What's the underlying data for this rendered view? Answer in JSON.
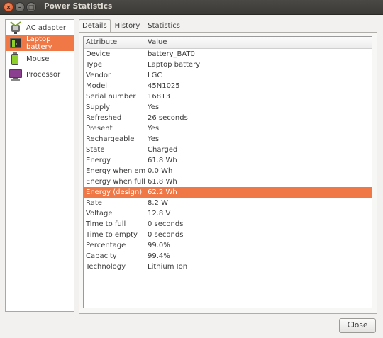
{
  "window": {
    "title": "Power Statistics",
    "close_glyph": "×",
    "minimize_glyph": "–",
    "maximize_glyph": "□"
  },
  "devices": [
    {
      "label": "AC adapter",
      "icon": "ac-adapter-icon",
      "selected": false
    },
    {
      "label": "Laptop battery",
      "icon": "battery-icon",
      "selected": true
    },
    {
      "label": "Mouse",
      "icon": "mouse-battery-icon",
      "selected": false
    },
    {
      "label": "Processor",
      "icon": "processor-icon",
      "selected": false
    }
  ],
  "tabs": [
    {
      "label": "Details",
      "active": true
    },
    {
      "label": "History",
      "active": false
    },
    {
      "label": "Statistics",
      "active": false
    }
  ],
  "table": {
    "headers": {
      "attribute": "Attribute",
      "value": "Value"
    },
    "rows": [
      {
        "attribute": "Device",
        "value": "battery_BAT0"
      },
      {
        "attribute": "Type",
        "value": "Laptop battery"
      },
      {
        "attribute": "Vendor",
        "value": "LGC"
      },
      {
        "attribute": "Model",
        "value": "45N1025"
      },
      {
        "attribute": "Serial number",
        "value": "16813"
      },
      {
        "attribute": "Supply",
        "value": "Yes"
      },
      {
        "attribute": "Refreshed",
        "value": "26 seconds"
      },
      {
        "attribute": "Present",
        "value": "Yes"
      },
      {
        "attribute": "Rechargeable",
        "value": "Yes"
      },
      {
        "attribute": "State",
        "value": "Charged"
      },
      {
        "attribute": "Energy",
        "value": "61.8 Wh"
      },
      {
        "attribute": "Energy when empty",
        "value": "0.0 Wh"
      },
      {
        "attribute": "Energy when full",
        "value": "61.8 Wh"
      },
      {
        "attribute": "Energy (design)",
        "value": "62.2 Wh",
        "selected": true
      },
      {
        "attribute": "Rate",
        "value": "8.2 W"
      },
      {
        "attribute": "Voltage",
        "value": "12.8 V"
      },
      {
        "attribute": "Time to full",
        "value": "0 seconds"
      },
      {
        "attribute": "Time to empty",
        "value": "0 seconds"
      },
      {
        "attribute": "Percentage",
        "value": "99.0%"
      },
      {
        "attribute": "Capacity",
        "value": "99.4%"
      },
      {
        "attribute": "Technology",
        "value": "Lithium Ion"
      }
    ]
  },
  "buttons": {
    "close_label": "Close"
  },
  "colors": {
    "selection": "#f07746",
    "titlebar": "#3b3a36",
    "window_bg": "#f2f1f0"
  }
}
